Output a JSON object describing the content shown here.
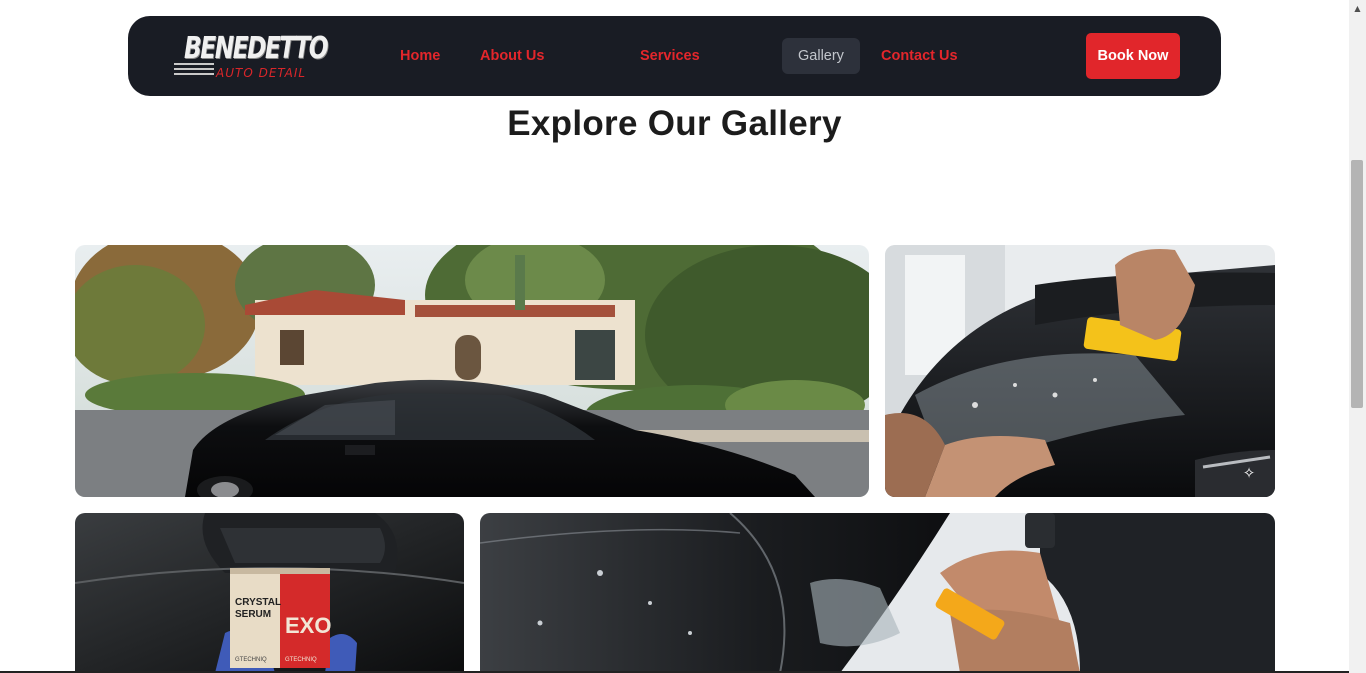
{
  "brand": {
    "name": "BENEDETTO",
    "tagline": "AUTO DETAIL"
  },
  "nav": {
    "home": "Home",
    "about": "About Us",
    "services": "Services",
    "gallery": "Gallery",
    "contact": "Contact Us",
    "active": "Gallery"
  },
  "cta": {
    "book_label": "Book Now"
  },
  "page": {
    "title": "Explore Our Gallery"
  },
  "gallery": {
    "images": [
      {
        "subject": "black sedan parked by a house"
      },
      {
        "subject": "paint protection film being applied to a black car"
      },
      {
        "subject": "crystal serum coating box on car hood"
      },
      {
        "subject": "hands squeegeeing film on a black car"
      }
    ],
    "box_text": {
      "line1": "CRYSTAL",
      "line2": "SERUM",
      "brand": "GTECHNIQ",
      "logo": "EXO"
    }
  },
  "colors": {
    "nav_bg": "#191c24",
    "accent": "#e1262b",
    "active_tab_bg": "#2d313b",
    "title": "#1c1c1c"
  },
  "icons": {
    "magic": "magic-wand-icon",
    "scroll_up": "arrow-up-icon"
  }
}
